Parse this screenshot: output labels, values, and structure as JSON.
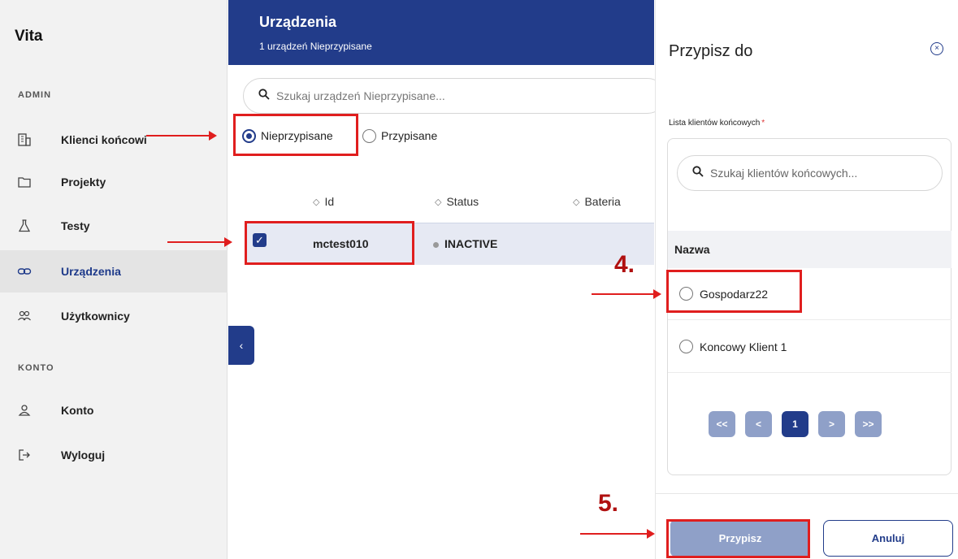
{
  "sidebar": {
    "brand": "Vita",
    "admin_label": "ADMIN",
    "account_label": "KONTO",
    "items": [
      {
        "label": "Klienci końcowi",
        "icon": "building-icon"
      },
      {
        "label": "Projekty",
        "icon": "folder-icon"
      },
      {
        "label": "Testy",
        "icon": "flask-icon"
      },
      {
        "label": "Urządzenia",
        "icon": "link-icon"
      },
      {
        "label": "Użytkownicy",
        "icon": "users-icon"
      },
      {
        "label": "Konto",
        "icon": "user-icon"
      },
      {
        "label": "Wyloguj",
        "icon": "logout-icon"
      }
    ]
  },
  "main": {
    "title": "Urządzenia",
    "subtitle": "1 urządzeń Nieprzypisane",
    "search_placeholder": "Szukaj urządzeń Nieprzypisane...",
    "filters": [
      {
        "label": "Nieprzypisane",
        "selected": true
      },
      {
        "label": "Przypisane",
        "selected": false
      }
    ],
    "columns": [
      "Id",
      "Status",
      "Bateria"
    ],
    "rows": [
      {
        "id": "mctest010",
        "status": "INACTIVE",
        "checked": true
      }
    ],
    "collapse_glyph": "‹"
  },
  "panel": {
    "title": "Przypisz do",
    "close_glyph": "×",
    "field_label": "Lista klientów końcowych",
    "required_mark": "*",
    "search_placeholder": "Szukaj klientów końcowych...",
    "column_header": "Nazwa",
    "clients": [
      "Gospodarz22",
      "Koncowy Klient 1"
    ],
    "pagination": {
      "first": "<<",
      "prev": "<",
      "current": "1",
      "next": ">",
      "last": ">>"
    },
    "assign_label": "Przypisz",
    "cancel_label": "Anuluj"
  },
  "annotations": {
    "step4": "4.",
    "step5": "5.",
    "color": "#e01e1e"
  },
  "colors": {
    "primary": "#223c8a",
    "primary_muted": "#8fa0c8"
  }
}
